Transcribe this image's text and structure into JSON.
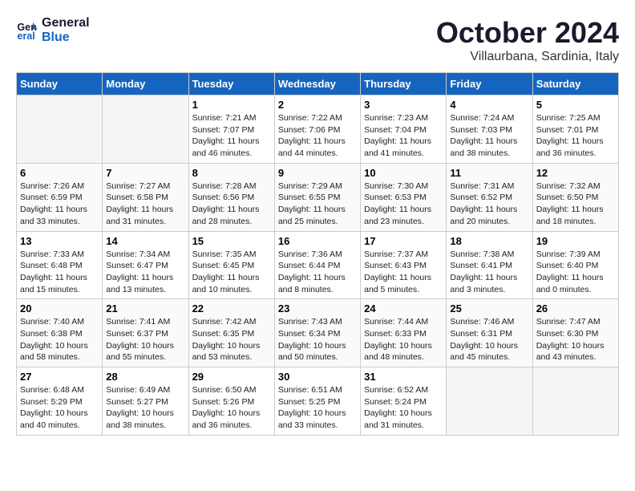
{
  "logo": {
    "line1": "General",
    "line2": "Blue"
  },
  "title": "October 2024",
  "subtitle": "Villaurbana, Sardinia, Italy",
  "headers": [
    "Sunday",
    "Monday",
    "Tuesday",
    "Wednesday",
    "Thursday",
    "Friday",
    "Saturday"
  ],
  "weeks": [
    [
      {
        "day": "",
        "info": ""
      },
      {
        "day": "",
        "info": ""
      },
      {
        "day": "1",
        "info": "Sunrise: 7:21 AM\nSunset: 7:07 PM\nDaylight: 11 hours and 46 minutes."
      },
      {
        "day": "2",
        "info": "Sunrise: 7:22 AM\nSunset: 7:06 PM\nDaylight: 11 hours and 44 minutes."
      },
      {
        "day": "3",
        "info": "Sunrise: 7:23 AM\nSunset: 7:04 PM\nDaylight: 11 hours and 41 minutes."
      },
      {
        "day": "4",
        "info": "Sunrise: 7:24 AM\nSunset: 7:03 PM\nDaylight: 11 hours and 38 minutes."
      },
      {
        "day": "5",
        "info": "Sunrise: 7:25 AM\nSunset: 7:01 PM\nDaylight: 11 hours and 36 minutes."
      }
    ],
    [
      {
        "day": "6",
        "info": "Sunrise: 7:26 AM\nSunset: 6:59 PM\nDaylight: 11 hours and 33 minutes."
      },
      {
        "day": "7",
        "info": "Sunrise: 7:27 AM\nSunset: 6:58 PM\nDaylight: 11 hours and 31 minutes."
      },
      {
        "day": "8",
        "info": "Sunrise: 7:28 AM\nSunset: 6:56 PM\nDaylight: 11 hours and 28 minutes."
      },
      {
        "day": "9",
        "info": "Sunrise: 7:29 AM\nSunset: 6:55 PM\nDaylight: 11 hours and 25 minutes."
      },
      {
        "day": "10",
        "info": "Sunrise: 7:30 AM\nSunset: 6:53 PM\nDaylight: 11 hours and 23 minutes."
      },
      {
        "day": "11",
        "info": "Sunrise: 7:31 AM\nSunset: 6:52 PM\nDaylight: 11 hours and 20 minutes."
      },
      {
        "day": "12",
        "info": "Sunrise: 7:32 AM\nSunset: 6:50 PM\nDaylight: 11 hours and 18 minutes."
      }
    ],
    [
      {
        "day": "13",
        "info": "Sunrise: 7:33 AM\nSunset: 6:48 PM\nDaylight: 11 hours and 15 minutes."
      },
      {
        "day": "14",
        "info": "Sunrise: 7:34 AM\nSunset: 6:47 PM\nDaylight: 11 hours and 13 minutes."
      },
      {
        "day": "15",
        "info": "Sunrise: 7:35 AM\nSunset: 6:45 PM\nDaylight: 11 hours and 10 minutes."
      },
      {
        "day": "16",
        "info": "Sunrise: 7:36 AM\nSunset: 6:44 PM\nDaylight: 11 hours and 8 minutes."
      },
      {
        "day": "17",
        "info": "Sunrise: 7:37 AM\nSunset: 6:43 PM\nDaylight: 11 hours and 5 minutes."
      },
      {
        "day": "18",
        "info": "Sunrise: 7:38 AM\nSunset: 6:41 PM\nDaylight: 11 hours and 3 minutes."
      },
      {
        "day": "19",
        "info": "Sunrise: 7:39 AM\nSunset: 6:40 PM\nDaylight: 11 hours and 0 minutes."
      }
    ],
    [
      {
        "day": "20",
        "info": "Sunrise: 7:40 AM\nSunset: 6:38 PM\nDaylight: 10 hours and 58 minutes."
      },
      {
        "day": "21",
        "info": "Sunrise: 7:41 AM\nSunset: 6:37 PM\nDaylight: 10 hours and 55 minutes."
      },
      {
        "day": "22",
        "info": "Sunrise: 7:42 AM\nSunset: 6:35 PM\nDaylight: 10 hours and 53 minutes."
      },
      {
        "day": "23",
        "info": "Sunrise: 7:43 AM\nSunset: 6:34 PM\nDaylight: 10 hours and 50 minutes."
      },
      {
        "day": "24",
        "info": "Sunrise: 7:44 AM\nSunset: 6:33 PM\nDaylight: 10 hours and 48 minutes."
      },
      {
        "day": "25",
        "info": "Sunrise: 7:46 AM\nSunset: 6:31 PM\nDaylight: 10 hours and 45 minutes."
      },
      {
        "day": "26",
        "info": "Sunrise: 7:47 AM\nSunset: 6:30 PM\nDaylight: 10 hours and 43 minutes."
      }
    ],
    [
      {
        "day": "27",
        "info": "Sunrise: 6:48 AM\nSunset: 5:29 PM\nDaylight: 10 hours and 40 minutes."
      },
      {
        "day": "28",
        "info": "Sunrise: 6:49 AM\nSunset: 5:27 PM\nDaylight: 10 hours and 38 minutes."
      },
      {
        "day": "29",
        "info": "Sunrise: 6:50 AM\nSunset: 5:26 PM\nDaylight: 10 hours and 36 minutes."
      },
      {
        "day": "30",
        "info": "Sunrise: 6:51 AM\nSunset: 5:25 PM\nDaylight: 10 hours and 33 minutes."
      },
      {
        "day": "31",
        "info": "Sunrise: 6:52 AM\nSunset: 5:24 PM\nDaylight: 10 hours and 31 minutes."
      },
      {
        "day": "",
        "info": ""
      },
      {
        "day": "",
        "info": ""
      }
    ]
  ]
}
